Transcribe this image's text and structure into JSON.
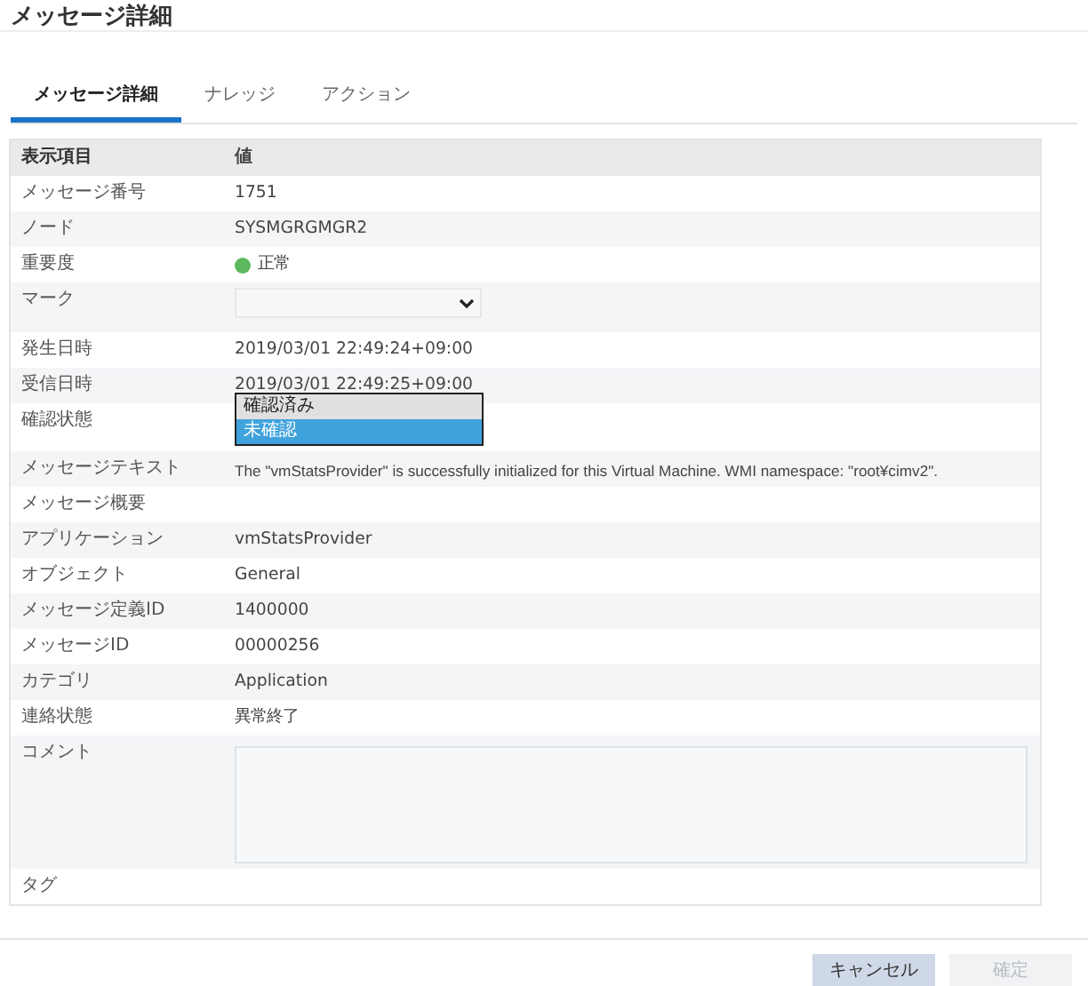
{
  "window": {
    "title": "メッセージ詳細"
  },
  "tabs": [
    {
      "label": "メッセージ詳細",
      "selected": true
    },
    {
      "label": "ナレッジ",
      "selected": false
    },
    {
      "label": "アクション",
      "selected": false
    }
  ],
  "table": {
    "columns": [
      "表示項目",
      "値"
    ],
    "rows": [
      {
        "kind": "text",
        "label": "メッセージ番号",
        "value": "1751"
      },
      {
        "kind": "text",
        "label": "ノード",
        "value": "SYSMGRGMGR2"
      },
      {
        "kind": "status",
        "label": "重要度",
        "value": "正常",
        "color": "#5cb85c"
      },
      {
        "kind": "select",
        "label": "マーク"
      },
      {
        "kind": "text",
        "label": "発生日時",
        "value": "2019/03/01 22:49:24+09:00"
      },
      {
        "kind": "text",
        "label": "受信日時",
        "value": "2019/03/01 22:49:25+09:00"
      },
      {
        "kind": "dropdown",
        "label": "確認状態",
        "options": [
          {
            "label": "確認済み",
            "selected": false
          },
          {
            "label": "未確認",
            "selected": true
          }
        ]
      },
      {
        "kind": "long_text",
        "label": "メッセージテキスト",
        "value": "The \"vmStatsProvider\" is successfully initialized for this Virtual Machine. WMI namespace: \"root¥cimv2\"."
      },
      {
        "kind": "text",
        "label": "メッセージ概要"
      },
      {
        "kind": "text",
        "label": "アプリケーション",
        "value": "vmStatsProvider"
      },
      {
        "kind": "text",
        "label": "オブジェクト",
        "value": "General"
      },
      {
        "kind": "text",
        "label": "メッセージ定義ID",
        "value": "1400000"
      },
      {
        "kind": "text",
        "label": "メッセージID",
        "value": "00000256"
      },
      {
        "kind": "text",
        "label": "カテゴリ",
        "value": "Application"
      },
      {
        "kind": "text",
        "label": "連絡状態",
        "value": "異常終了"
      },
      {
        "kind": "textarea",
        "label": "コメント"
      },
      {
        "kind": "text",
        "label": "タグ"
      }
    ]
  },
  "buttons": [
    {
      "label": "キャンセル",
      "disabled": false
    },
    {
      "label": "確定",
      "disabled": true
    }
  ]
}
